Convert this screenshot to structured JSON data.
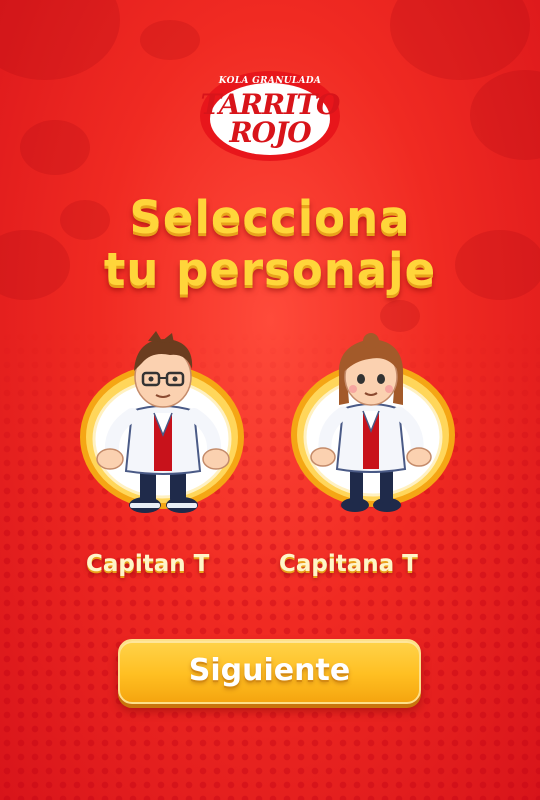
{
  "brand": {
    "tagline": "KOLA GRANULADA",
    "name_line1": "TARRITO",
    "name_line2": "ROJO",
    "colors": {
      "red": "#e8161b",
      "white": "#ffffff"
    }
  },
  "headline": {
    "line1": "Selecciona",
    "line2": "tu personaje",
    "color": "#ffd53a"
  },
  "characters": [
    {
      "name": "Capitan T",
      "avatar_icon": "male-scientist-character",
      "frame_color": "#f7b21a"
    },
    {
      "name": "Capitana T",
      "avatar_icon": "female-scientist-character",
      "frame_color": "#f7b21a"
    }
  ],
  "next_button": {
    "label": "Siguiente",
    "color": "#ffbf22"
  },
  "background": {
    "color": "#f02a22"
  }
}
